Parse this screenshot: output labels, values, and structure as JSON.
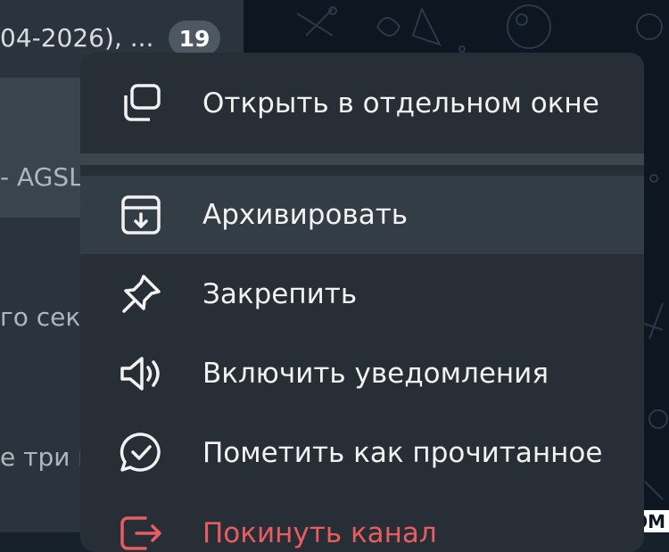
{
  "chat_list": {
    "previews": [
      "04-2026), ...",
      "- AGSL",
      "го сек",
      "е три ц"
    ],
    "unread_badge": "19"
  },
  "background": {
    "bottom_label": "OM"
  },
  "context_menu": {
    "items": [
      {
        "label": "Открыть в отдельном окне",
        "icon": "open-window-icon"
      },
      {
        "label": "Архивировать",
        "icon": "archive-icon",
        "highlighted": true
      },
      {
        "label": "Закрепить",
        "icon": "pin-icon"
      },
      {
        "label": "Включить уведомления",
        "icon": "speaker-icon"
      },
      {
        "label": "Пометить как прочитанное",
        "icon": "chat-check-icon"
      },
      {
        "label": "Покинуть канал",
        "icon": "leave-icon",
        "danger": true
      }
    ]
  },
  "colors": {
    "menu_bg": "#272e35",
    "highlight": "#333d45",
    "danger": "#e85d62",
    "badge": "#4d5862"
  }
}
